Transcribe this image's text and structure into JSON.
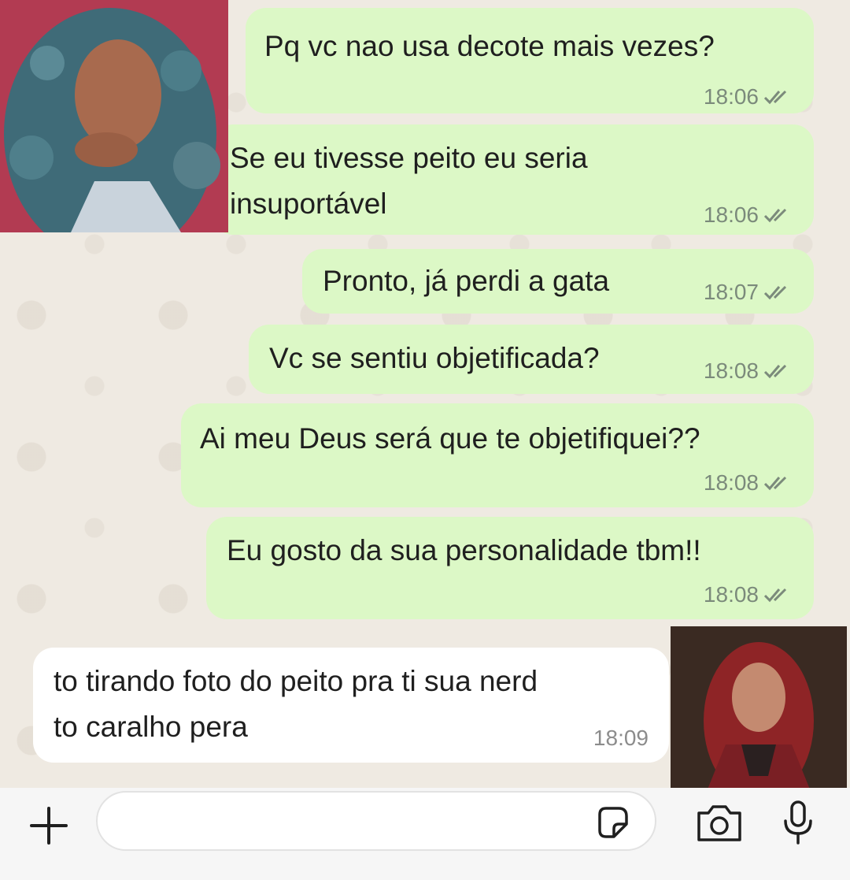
{
  "messages": [
    {
      "direction": "out",
      "text_lines": [
        "Pq vc nao usa decote mais vezes?"
      ],
      "time": "18:06",
      "read": true
    },
    {
      "direction": "out",
      "text_lines": [
        "Se eu tivesse peito eu seria",
        "insuportável"
      ],
      "time": "18:06",
      "read": true
    },
    {
      "direction": "out",
      "text_lines": [
        "Pronto, já perdi a gata"
      ],
      "time": "18:07",
      "read": true
    },
    {
      "direction": "out",
      "text_lines": [
        "Vc se sentiu objetificada?"
      ],
      "time": "18:08",
      "read": true
    },
    {
      "direction": "out",
      "text_lines": [
        "Ai meu Deus será que te objetifiquei??"
      ],
      "time": "18:08",
      "read": true
    },
    {
      "direction": "out",
      "text_lines": [
        "Eu gosto da sua personalidade tbm!!"
      ],
      "time": "18:08",
      "read": true
    },
    {
      "direction": "in",
      "text_lines": [
        "to tirando foto do peito pra ti sua nerd",
        "to caralho pera"
      ],
      "time": "18:09",
      "read": false
    }
  ],
  "composer": {
    "icons": [
      "plus-icon",
      "sticker-icon",
      "camera-icon",
      "mic-icon"
    ]
  },
  "colors": {
    "outgoing_bubble": "#dcf8c6",
    "incoming_bubble": "#ffffff",
    "chat_background": "#efeae2",
    "tick_color": "#7b8a7b"
  }
}
